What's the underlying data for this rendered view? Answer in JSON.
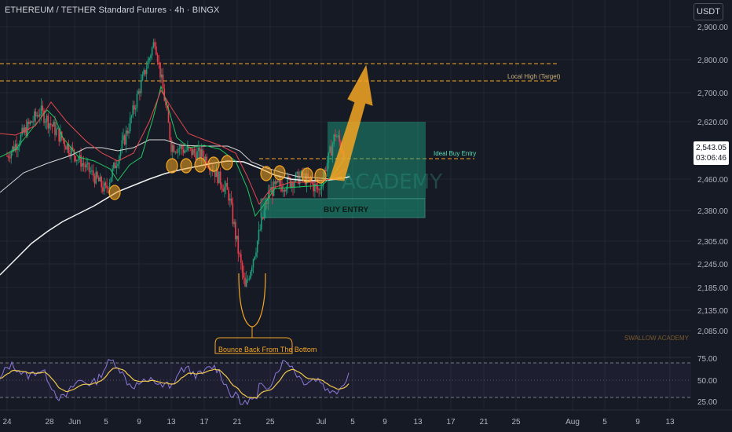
{
  "header": {
    "title": "ETHEREUM / TETHER Standard Futures · 4h · BINGX",
    "currency_button": "USDT"
  },
  "current_price": {
    "price": "2,543.05",
    "countdown": "03:06:46"
  },
  "colors": {
    "background": "#161a25",
    "grid": "#232734",
    "bull_candle": "#1f9e7a",
    "bear_candle": "#ef3b4b",
    "ema_fast": "#22c55e",
    "ema_mid": "#e5484d",
    "ema_slow": "#f2f2f2",
    "annotation": "#f5a623",
    "box_fill": "#1aa383",
    "rsi_line": "#8b79d9",
    "rsi_ma": "#f2c84b"
  },
  "chart_data": {
    "type": "candlestick",
    "title": "ETHEREUM / TETHER Standard Futures · 4h · BINGX",
    "y_axis_ticks": [
      "2,900.00",
      "2,800.00",
      "2,700.00",
      "2,620.00",
      "2,543.05",
      "2,460.00",
      "2,380.00",
      "2,305.00",
      "2,245.00",
      "2,185.00",
      "2,135.00",
      "2,085.00"
    ],
    "x_axis_ticks": [
      "24",
      "28",
      "Jun",
      "5",
      "9",
      "13",
      "17",
      "21",
      "25",
      "Jul",
      "5",
      "9",
      "13",
      "17",
      "21",
      "25",
      "Aug",
      "5",
      "9",
      "13"
    ],
    "approx_price_path": [
      {
        "date": "May 24",
        "price": 2530
      },
      {
        "date": "May 28",
        "price": 2650
      },
      {
        "date": "Jun 1",
        "price": 2540
      },
      {
        "date": "Jun 5",
        "price": 2430
      },
      {
        "date": "Jun 8",
        "price": 2620
      },
      {
        "date": "Jun 11",
        "price": 2860
      },
      {
        "date": "Jun 13",
        "price": 2560
      },
      {
        "date": "Jun 17",
        "price": 2530
      },
      {
        "date": "Jun 20",
        "price": 2420
      },
      {
        "date": "Jun 22",
        "price": 2180
      },
      {
        "date": "Jun 25",
        "price": 2430
      },
      {
        "date": "Jun 29",
        "price": 2470
      },
      {
        "date": "Jul 1",
        "price": 2430
      },
      {
        "date": "Jul 3",
        "price": 2590
      },
      {
        "date": "Jul 4",
        "price": 2543
      }
    ],
    "levels": [
      {
        "label": "Local High (Target)",
        "upper": 2790,
        "lower": 2745
      },
      {
        "label": "Ideal Buy Entry",
        "price": 2520
      }
    ],
    "zones": [
      {
        "label": "BUY ENTRY",
        "from": 2390,
        "to": 2425
      },
      {
        "label": "",
        "from": 2430,
        "to": 2590
      }
    ],
    "annotations": [
      "Local High (Target)",
      "Ideal Buy Entry",
      "BUY ENTRY",
      "SWALLOW ACADEMY",
      "Bounce Back From The Bottom"
    ],
    "watermark": "ACADEMY",
    "rsi": {
      "ticks": [
        "75.00",
        "50.00",
        "25.00"
      ],
      "upper": 70,
      "lower": 30,
      "last": 62
    }
  }
}
